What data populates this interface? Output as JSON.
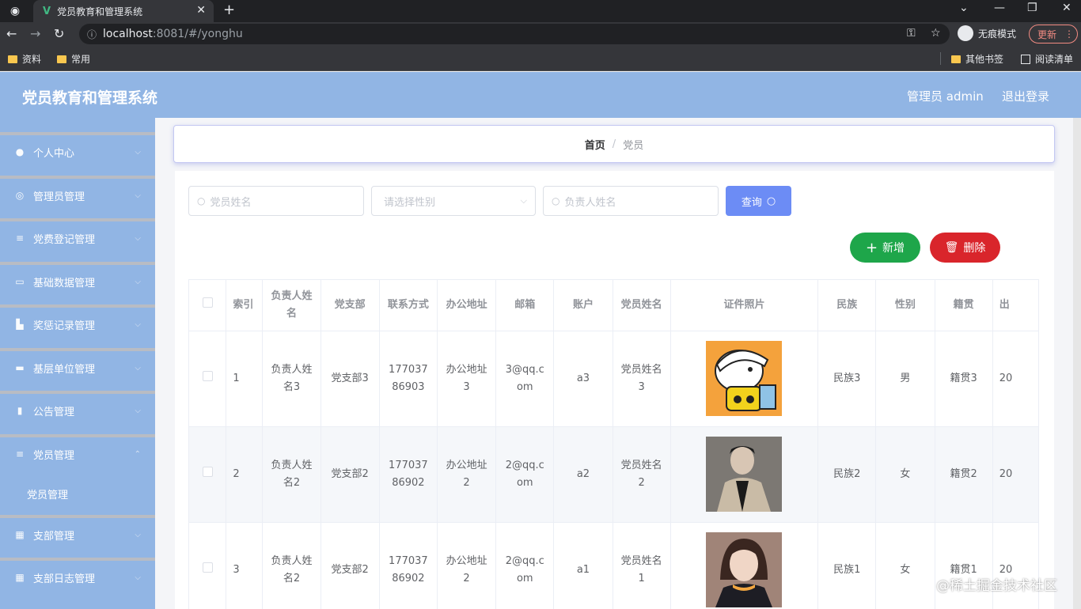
{
  "browser": {
    "tab_title": "党员教育和管理系统",
    "url_host": "localhost",
    "url_path": ":8081/#/yonghu",
    "incognito_label": "无痕模式",
    "update_label": "更新",
    "bookmarks": [
      "资料",
      "常用"
    ],
    "bookmarks_right": [
      "其他书签",
      "阅读清单"
    ]
  },
  "header": {
    "title": "党员教育和管理系统",
    "admin_label": "管理员 admin",
    "logout_label": "退出登录"
  },
  "sidebar": {
    "items": [
      {
        "label": "个人中心",
        "icon": "user-icon"
      },
      {
        "label": "管理员管理",
        "icon": "compass-icon"
      },
      {
        "label": "党费登记管理",
        "icon": "list-icon"
      },
      {
        "label": "基础数据管理",
        "icon": "chat-icon"
      },
      {
        "label": "奖惩记录管理",
        "icon": "chart-icon"
      },
      {
        "label": "基层单位管理",
        "icon": "briefcase-icon"
      },
      {
        "label": "公告管理",
        "icon": "mic-icon"
      },
      {
        "label": "党员管理",
        "icon": "list-icon"
      },
      {
        "label": "支部管理",
        "icon": "grid-icon"
      },
      {
        "label": "支部日志管理",
        "icon": "grid-icon"
      }
    ],
    "submenu_label": "党员管理"
  },
  "breadcrumb": {
    "home": "首页",
    "separator": "/",
    "current": "党员"
  },
  "search": {
    "name_placeholder": "党员姓名",
    "gender_placeholder": "请选择性别",
    "leader_placeholder": "负责人姓名",
    "query_label": "查询"
  },
  "actions": {
    "add_label": "新增",
    "delete_label": "删除"
  },
  "table": {
    "columns": [
      "索引",
      "负责人姓名",
      "党支部",
      "联系方式",
      "办公地址",
      "邮箱",
      "账户",
      "党员姓名",
      "证件照片",
      "民族",
      "性别",
      "籍贯",
      "出"
    ],
    "rows": [
      {
        "index": "1",
        "leader": "负责人姓名3",
        "branch": "党支部3",
        "phone": "17703786903",
        "office": "办公地址3",
        "email": "3@qq.com",
        "account": "a3",
        "member": "党员姓名3",
        "photo": "cartoon-photo",
        "ethnicity": "民族3",
        "gender": "男",
        "origin": "籍贯3",
        "extra": "20"
      },
      {
        "index": "2",
        "leader": "负责人姓名2",
        "branch": "党支部2",
        "phone": "17703786902",
        "office": "办公地址2",
        "email": "2@qq.com",
        "account": "a2",
        "member": "党员姓名2",
        "photo": "man-photo",
        "ethnicity": "民族2",
        "gender": "女",
        "origin": "籍贯2",
        "extra": "20"
      },
      {
        "index": "3",
        "leader": "负责人姓名2",
        "branch": "党支部2",
        "phone": "17703786902",
        "office": "办公地址2",
        "email": "2@qq.com",
        "account": "a1",
        "member": "党员姓名1",
        "photo": "woman-photo",
        "ethnicity": "民族1",
        "gender": "女",
        "origin": "籍贯1",
        "extra": "20"
      }
    ]
  },
  "watermark": "@稀土掘金技术社区",
  "colors": {
    "header_bg": "#91b5e4",
    "query_btn": "#6c8cf5",
    "add_btn": "#1ea64a",
    "delete_btn": "#d9252b"
  }
}
